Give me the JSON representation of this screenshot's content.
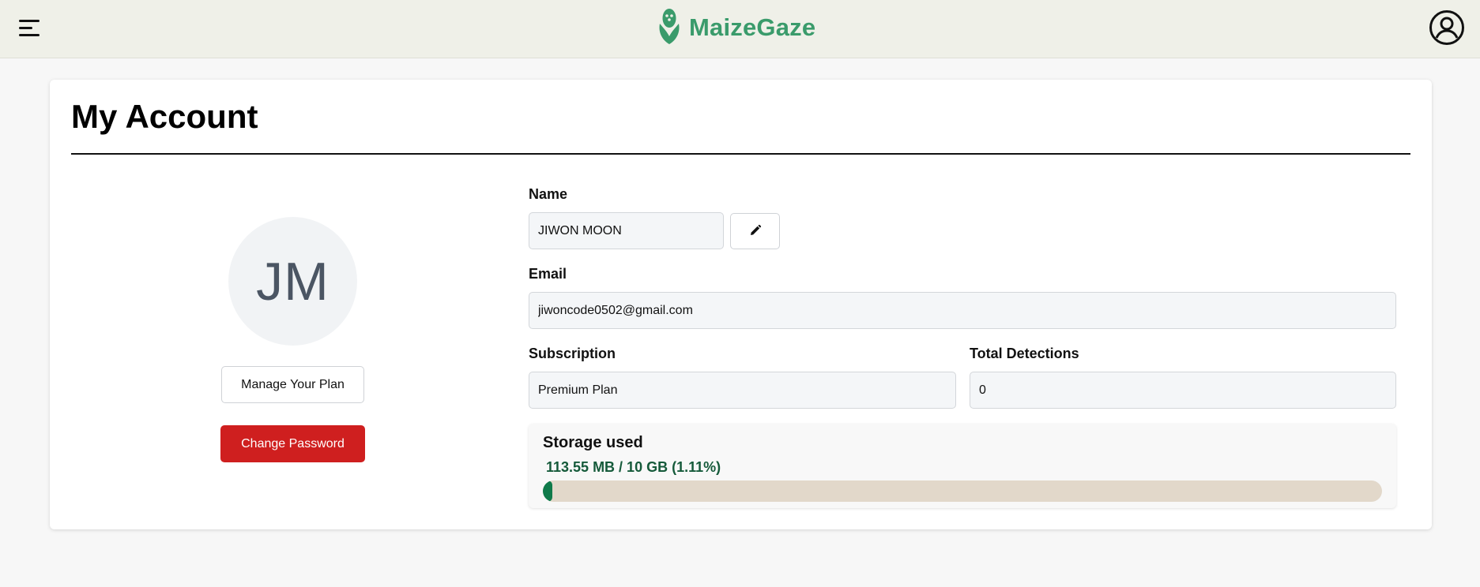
{
  "header": {
    "brand_name": "MaizeGaze",
    "brand_color": "#3a9b6b",
    "menu_icon": "hamburger-menu-icon",
    "logo_icon": "corn-logo-icon",
    "profile_icon": "user-circle-icon"
  },
  "page": {
    "title": "My Account"
  },
  "profile": {
    "avatar_initials": "JM",
    "manage_plan_label": "Manage Your Plan",
    "change_password_label": "Change Password",
    "change_password_color": "#cf1f1f"
  },
  "form": {
    "name": {
      "label": "Name",
      "value": "JIWON MOON",
      "edit_icon": "pencil-icon"
    },
    "email": {
      "label": "Email",
      "value": "jiwoncode0502@gmail.com"
    },
    "subscription": {
      "label": "Subscription",
      "value": "Premium Plan"
    },
    "total_detections": {
      "label": "Total Detections",
      "value": "0"
    }
  },
  "storage": {
    "title": "Storage used",
    "usage_text": "113.55 MB / 10 GB (1.11%)",
    "used_percent": 1.11,
    "bar_color": "#0f7a4a",
    "track_color": "#e2d8ca"
  }
}
